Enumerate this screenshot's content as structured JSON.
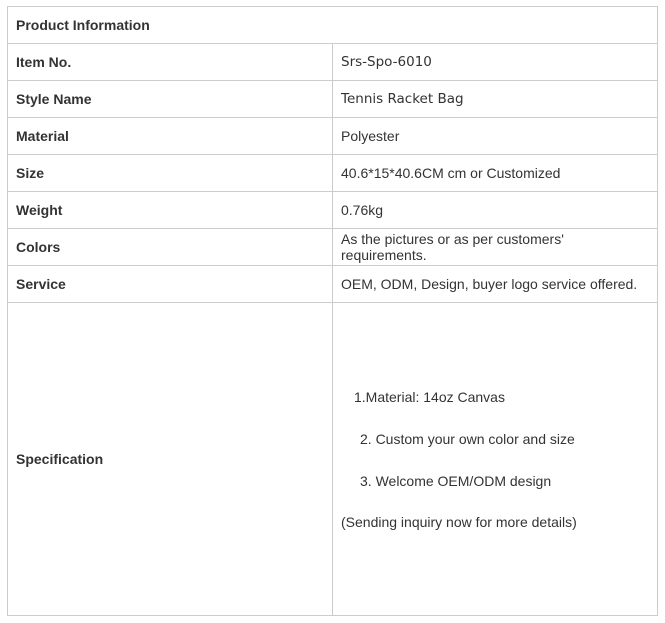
{
  "table": {
    "header": "Product Information",
    "rows": [
      {
        "label": "Item No.",
        "value": "Srs-Spo-6010"
      },
      {
        "label": "Style Name",
        "value": "Tennis Racket Bag"
      },
      {
        "label": "Material",
        "value": "Polyester"
      },
      {
        "label": "Size",
        "value": "40.6*15*40.6CM cm or Customized"
      },
      {
        "label": "Weight",
        "value": "0.76kg"
      },
      {
        "label": "Colors",
        "value": "As the pictures or as per customers' requirements."
      },
      {
        "label": "Service",
        "value": "OEM, ODM, Design, buyer logo service offered."
      }
    ],
    "specification": {
      "label": "Specification",
      "lines": [
        "1.Material:  14oz Canvas",
        "2. Custom your own color and size",
        "3. Welcome OEM/ODM design",
        "(Sending inquiry now for more details)"
      ]
    }
  }
}
